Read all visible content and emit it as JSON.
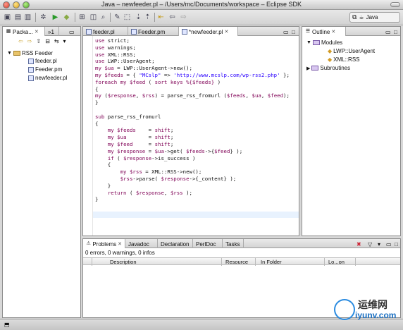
{
  "window": {
    "title": "Java – newfeeder.pl – /Users/mc/Documents/workspace – Eclipse SDK"
  },
  "toolbar": {
    "perspective_label": "Java"
  },
  "package_explorer": {
    "tab_label": "Packa...",
    "tab2_label": "»1",
    "project": "RSS Feeder",
    "files": [
      "feeder.pl",
      "Feeder.pm",
      "newfeeder.pl"
    ]
  },
  "editor": {
    "tabs": [
      {
        "label": "feeder.pl"
      },
      {
        "label": "Feeder.pm"
      },
      {
        "label": "*newfeeder.pl"
      }
    ],
    "code_lines": [
      "use strict;",
      "use warnings;",
      "use XML::RSS;",
      "use LWP::UserAgent;",
      "my $ua = LWP::UserAgent->new();",
      "my $feeds = { \"MCslp\" => 'http://www.mcslp.com/wp-rss2.php' };",
      "foreach my $feed ( sort keys %{$feeds} )",
      "{",
      "my ($response, $rss) = parse_rss_fromurl ($feeds, $ua, $feed);",
      "}",
      "",
      "sub parse_rss_fromurl",
      "{",
      "    my $feeds    = shift;",
      "    my $ua       = shift;",
      "    my $feed     = shift;",
      "    my $response = $ua->get( $feeds->{$feed} );",
      "    if ( $response->is_success )",
      "    {",
      "        my $rss = XML::RSS->new();",
      "        $rss->parse( $response->{_content} );",
      "    }",
      "    return ( $response, $rss );",
      "}"
    ]
  },
  "outline": {
    "tab_label": "Outline",
    "modules_label": "Modules",
    "modules": [
      "LWP::UserAgent",
      "XML::RSS"
    ],
    "subroutines_label": "Subroutines"
  },
  "bottom": {
    "tabs": [
      "Problems",
      "Javadoc",
      "Declaration",
      "PerlDoc",
      "Tasks"
    ],
    "summary": "0 errors, 0 warnings, 0 infos",
    "columns": [
      "Description",
      "Resource",
      "In Folder",
      "Lo...on"
    ]
  },
  "watermark": {
    "line1": "运维网",
    "line2": "iyunv.com"
  }
}
